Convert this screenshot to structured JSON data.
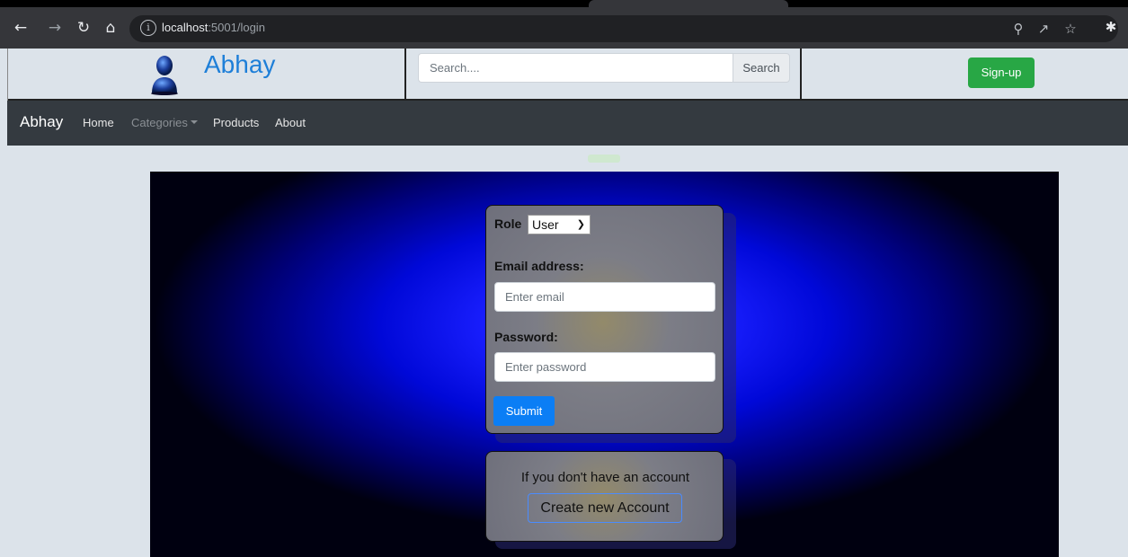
{
  "browser": {
    "url_host": "localhost",
    "url_rest": ":5001/login",
    "icons": [
      "back-icon",
      "forward-icon",
      "reload-icon",
      "home-icon",
      "info-icon",
      "zoom-icon",
      "share-icon",
      "bookmark-star-icon",
      "extensions-icon"
    ]
  },
  "header": {
    "brand_title": "Abhay",
    "search_placeholder": "Search....",
    "search_button": "Search",
    "signup_button": "Sign-up"
  },
  "navbar": {
    "brand": "Abhay",
    "links": [
      {
        "label": "Home"
      },
      {
        "label": "Categories"
      },
      {
        "label": "Products"
      },
      {
        "label": "About"
      }
    ]
  },
  "login": {
    "role_label": "Role",
    "role_selected": "User",
    "email_label": "Email address:",
    "email_placeholder": "Enter email",
    "password_label": "Password:",
    "password_placeholder": "Enter password",
    "submit": "Submit"
  },
  "signup_prompt": {
    "text": "If you don't have an account",
    "button": "Create new Account"
  },
  "colors": {
    "brand_blue": "#1e7fd8",
    "signup_green": "#28a745",
    "navbar_bg": "#343a40",
    "submit_blue": "#0b7ef5"
  }
}
